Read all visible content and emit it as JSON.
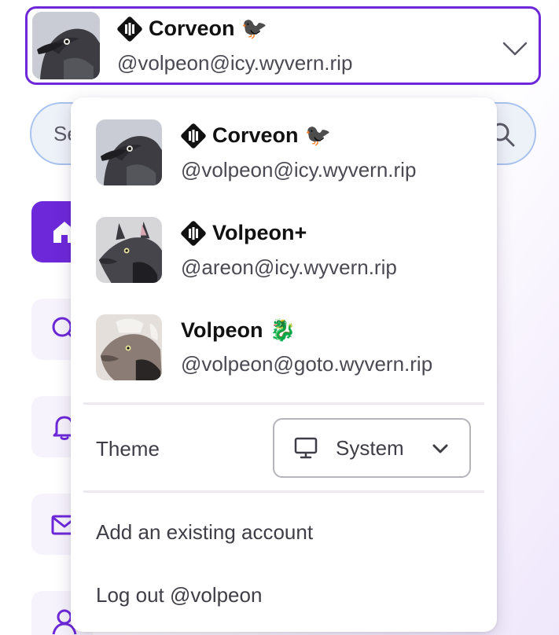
{
  "current_account": {
    "name": "Corveon",
    "name_emoji": "🐦‍⬛",
    "handle": "@volpeon@icy.wyvern.rip",
    "has_bot_badge": true
  },
  "search": {
    "placeholder_fragment": "Se"
  },
  "nav": {
    "icons": [
      "home-icon",
      "search-icon",
      "bell-icon",
      "mail-icon",
      "user-icon"
    ],
    "active": "home"
  },
  "menu": {
    "accounts": [
      {
        "name": "Corveon",
        "name_emoji": "🐦‍⬛",
        "handle": "@volpeon@icy.wyvern.rip",
        "bot_badge": true
      },
      {
        "name": "Volpeon+",
        "name_emoji": "",
        "handle": "@areon@icy.wyvern.rip",
        "bot_badge": true
      },
      {
        "name": "Volpeon",
        "name_emoji": "🐉",
        "handle": "@volpeon@goto.wyvern.rip",
        "bot_badge": false
      }
    ],
    "theme": {
      "label": "Theme",
      "value": "System",
      "icon": "monitor-icon"
    },
    "add_account": "Add an existing account",
    "logout": "Log out @volpeon"
  },
  "colors": {
    "accent": "#6d28d9",
    "search_border": "#a8c2ef",
    "search_bg": "#edf1f8",
    "text_secondary": "#4b4a52"
  }
}
